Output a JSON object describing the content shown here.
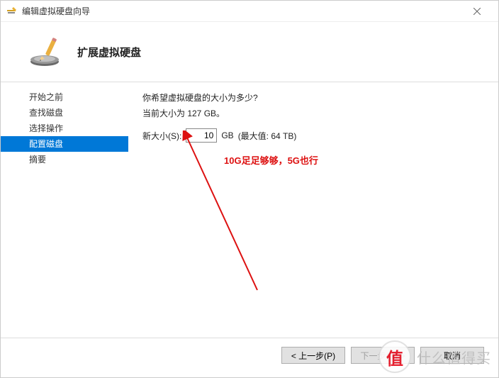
{
  "titlebar": {
    "title": "编辑虚拟硬盘向导"
  },
  "header": {
    "title": "扩展虚拟硬盘"
  },
  "sidebar": {
    "items": [
      {
        "label": "开始之前",
        "active": false
      },
      {
        "label": "查找磁盘",
        "active": false
      },
      {
        "label": "选择操作",
        "active": false
      },
      {
        "label": "配置磁盘",
        "active": true
      },
      {
        "label": "摘要",
        "active": false
      }
    ]
  },
  "content": {
    "question": "你希望虚拟硬盘的大小为多少?",
    "current_size": "当前大小为 127 GB。",
    "size_label": "新大小(S):",
    "size_value": "10",
    "size_unit": "GB",
    "size_max": "(最大值: 64 TB)"
  },
  "annotation": {
    "text": "10G足足够够，5G也行"
  },
  "footer": {
    "prev": "< 上一步(P)",
    "next": "下一步(N) >",
    "cancel": "取消"
  },
  "watermark": {
    "logo": "值",
    "text": "什么值得买"
  }
}
